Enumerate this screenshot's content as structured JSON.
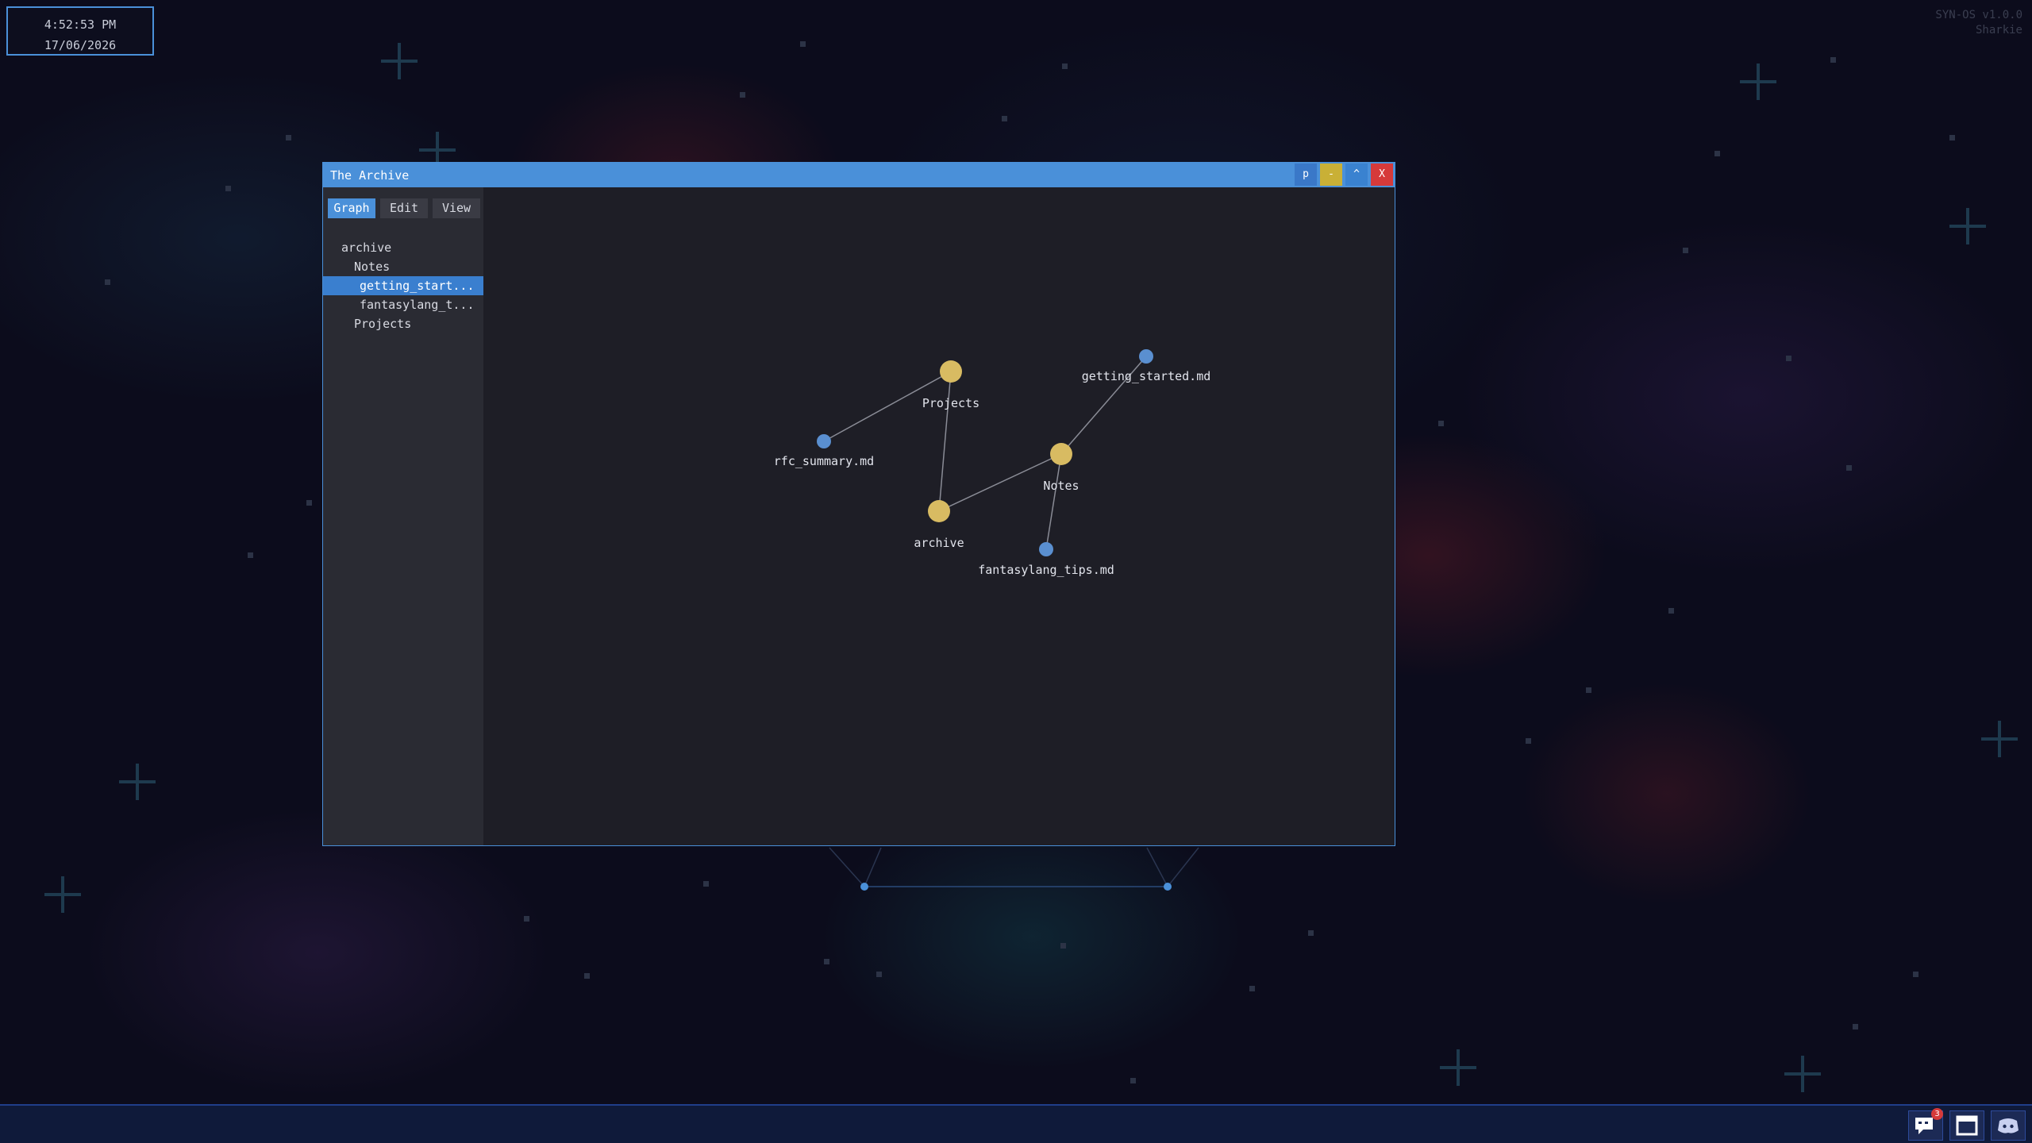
{
  "desktop": {
    "clock_time": "4:52:53 PM",
    "clock_date": "17/06/2026",
    "os_version": "SYN-OS v1.0.0",
    "user_name": "Sharkie"
  },
  "window": {
    "title": "The Archive",
    "pin_label": "p",
    "minimize_label": "-",
    "maximize_label": "^",
    "close_label": "X",
    "title_color": "#4a90d9"
  },
  "tabs": {
    "graph": "Graph",
    "edit": "Edit",
    "view": "View",
    "active": "Graph"
  },
  "tree": {
    "items": [
      {
        "label": "archive",
        "depth": 0,
        "selected": false
      },
      {
        "label": "Notes",
        "depth": 1,
        "selected": false
      },
      {
        "label": "getting_start...",
        "depth": 2,
        "selected": true
      },
      {
        "label": "fantasylang_t...",
        "depth": 2,
        "selected": false
      },
      {
        "label": "Projects",
        "depth": 1,
        "selected": false
      }
    ]
  },
  "graph": {
    "folder_color": "#d8bb62",
    "file_color": "#5a8fd0",
    "nodes": [
      {
        "id": "Projects",
        "label": "Projects",
        "kind": "folder"
      },
      {
        "id": "getting_started",
        "label": "getting_started.md",
        "kind": "file"
      },
      {
        "id": "rfc_summary",
        "label": "rfc_summary.md",
        "kind": "file"
      },
      {
        "id": "Notes",
        "label": "Notes",
        "kind": "folder"
      },
      {
        "id": "archive",
        "label": "archive",
        "kind": "folder"
      },
      {
        "id": "fantasylang_tips",
        "label": "fantasylang_tips.md",
        "kind": "file"
      }
    ],
    "edges": [
      [
        "Projects",
        "rfc_summary"
      ],
      [
        "Projects",
        "archive"
      ],
      [
        "archive",
        "Notes"
      ],
      [
        "Notes",
        "getting_started"
      ],
      [
        "Notes",
        "fantasylang_tips"
      ]
    ]
  },
  "taskbar": {
    "chat_badge": "3",
    "items": [
      "chat-app",
      "window-manager",
      "discord"
    ]
  }
}
